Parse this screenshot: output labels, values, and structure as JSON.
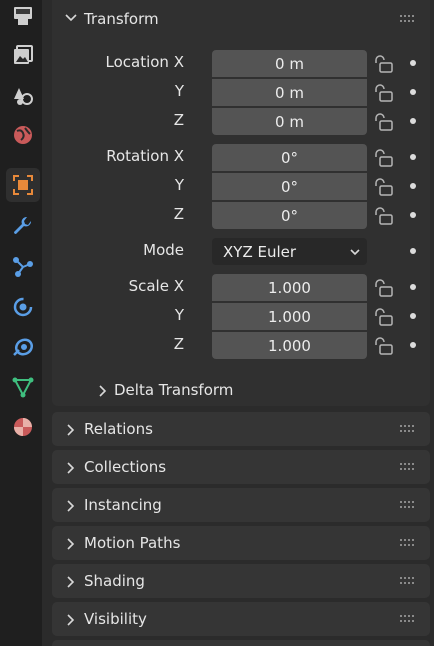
{
  "transform_panel": {
    "title": "Transform",
    "location": {
      "label_x": "Location X",
      "label_y": "Y",
      "label_z": "Z",
      "x": "0 m",
      "y": "0 m",
      "z": "0 m"
    },
    "rotation": {
      "label_x": "Rotation X",
      "label_y": "Y",
      "label_z": "Z",
      "x": "0°",
      "y": "0°",
      "z": "0°"
    },
    "mode": {
      "label": "Mode",
      "value": "XYZ Euler"
    },
    "scale": {
      "label_x": "Scale X",
      "label_y": "Y",
      "label_z": "Z",
      "x": "1.000",
      "y": "1.000",
      "z": "1.000"
    },
    "delta_transform": "Delta Transform"
  },
  "collapsed_panels": [
    "Relations",
    "Collections",
    "Instancing",
    "Motion Paths",
    "Shading",
    "Visibility"
  ],
  "tabs": [
    {
      "icon": "render-icon"
    },
    {
      "icon": "output-icon"
    },
    {
      "icon": "scene-icon"
    },
    {
      "icon": "world-icon"
    },
    {
      "icon": "object-icon",
      "active": true
    },
    {
      "icon": "modifier-wrench-icon"
    },
    {
      "icon": "particles-icon"
    },
    {
      "icon": "physics-icon"
    },
    {
      "icon": "constraints-icon"
    },
    {
      "icon": "mesh-data-icon"
    },
    {
      "icon": "material-icon"
    }
  ],
  "colors": {
    "accent_orange": "#e8893a",
    "icon_blue": "#5a9ee6",
    "icon_green": "#3fbf7f",
    "icon_red": "#c95a5a"
  }
}
